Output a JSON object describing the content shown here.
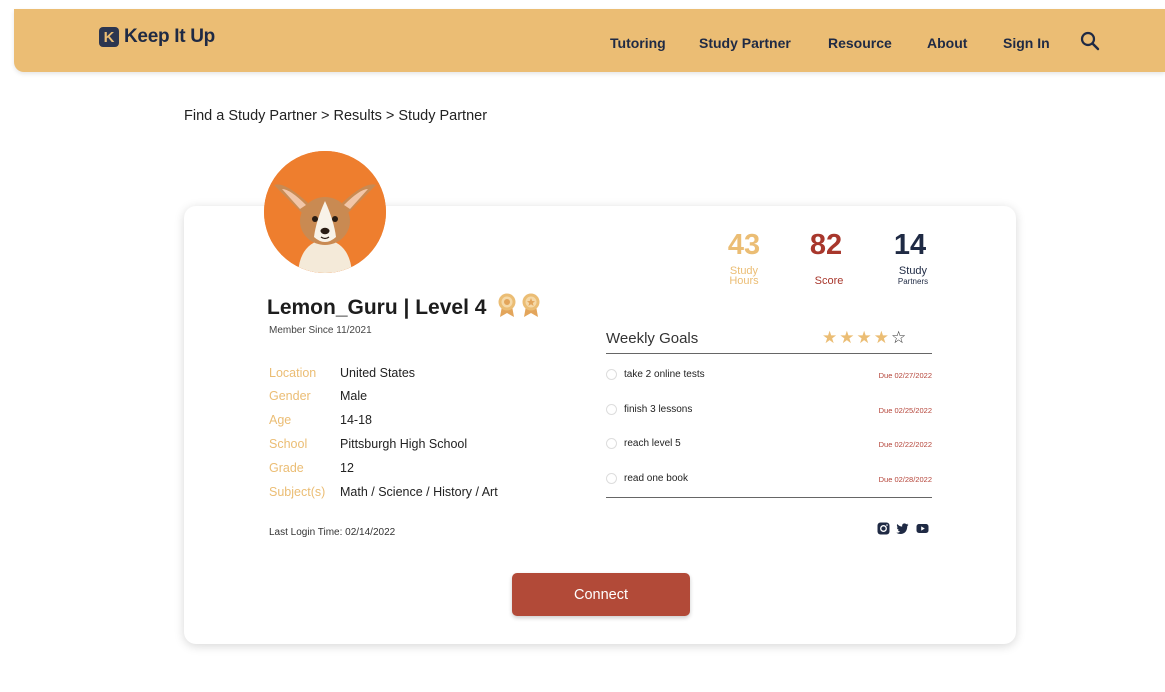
{
  "nav": {
    "brand": "Keep It Up",
    "logo_letter": "K",
    "items": [
      "Tutoring",
      "Study Partner",
      "Resource",
      "About",
      "Sign In"
    ]
  },
  "breadcrumb": "Find a Study Partner > Results > Study Partner",
  "profile": {
    "username_line": "Lemon_Guru | Level 4",
    "member_since": "Member Since 11/2021",
    "info": [
      {
        "label": "Location",
        "value": "United States"
      },
      {
        "label": "Gender",
        "value": "Male"
      },
      {
        "label": "Age",
        "value": "14-18"
      },
      {
        "label": "School",
        "value": "Pittsburgh High School"
      },
      {
        "label": "Grade",
        "value": "12"
      },
      {
        "label": "Subject(s)",
        "value": "Math / Science / History / Art"
      }
    ],
    "last_login": "Last Login Time: 02/14/2022"
  },
  "stats": [
    {
      "value": "43",
      "label_line1": "Study",
      "label_line2": "Hours",
      "color": "#ebbd74"
    },
    {
      "value": "82",
      "label_line1": "Score",
      "label_line2": "",
      "color": "#a8372c"
    },
    {
      "value": "14",
      "label_line1": "Study",
      "label_line2": "Partners",
      "color": "#1f2a44"
    }
  ],
  "weekly_goals": {
    "title": "Weekly Goals",
    "rating": 4,
    "rating_max": 5,
    "items": [
      {
        "text": "take 2 online tests",
        "due": "Due 02/27/2022"
      },
      {
        "text": "finish 3 lessons",
        "due": "Due 02/25/2022"
      },
      {
        "text": "reach level 5",
        "due": "Due 02/22/2022"
      },
      {
        "text": "read one book",
        "due": "Due 02/28/2022"
      }
    ]
  },
  "social": [
    "instagram-icon",
    "twitter-icon",
    "youtube-icon"
  ],
  "connect_label": "Connect",
  "colors": {
    "nav_bg": "#ebbd74",
    "accent_gold": "#ebbd74",
    "accent_red": "#b24a38",
    "navy": "#1f2a44"
  }
}
